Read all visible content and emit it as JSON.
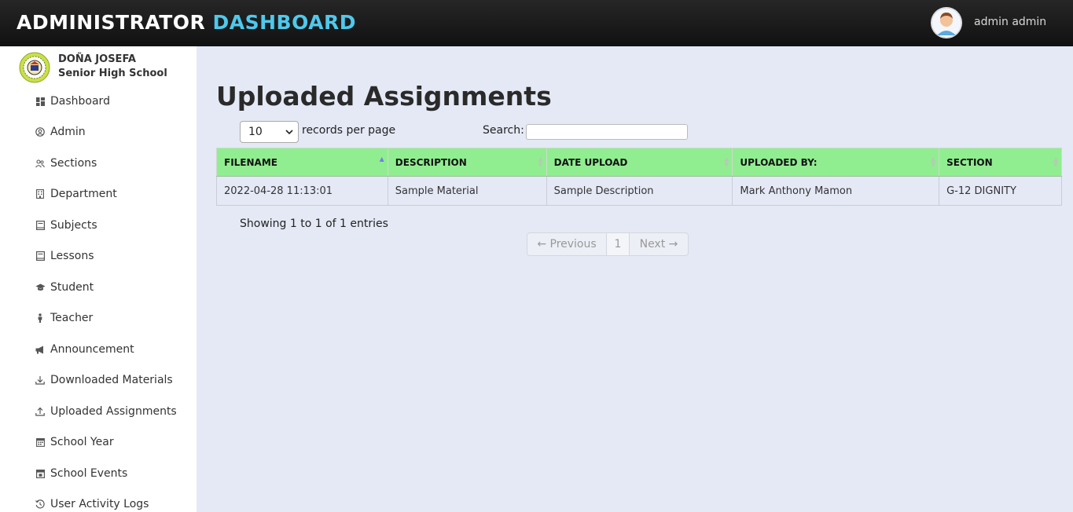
{
  "header": {
    "brand_white": "ADMINISTRATOR",
    "brand_blue": "DASHBOARD",
    "username": "admin admin"
  },
  "school": {
    "line1": "DOÑA JOSEFA",
    "line2": "Senior High School"
  },
  "sidebar": {
    "items": [
      {
        "label": "Dashboard",
        "icon": "dashboard-icon"
      },
      {
        "label": "Admin",
        "icon": "user-circle-icon"
      },
      {
        "label": "Sections",
        "icon": "users-icon"
      },
      {
        "label": "Department",
        "icon": "building-icon"
      },
      {
        "label": "Subjects",
        "icon": "book-icon"
      },
      {
        "label": "Lessons",
        "icon": "book-icon"
      },
      {
        "label": "Student",
        "icon": "graduation-cap-icon"
      },
      {
        "label": "Teacher",
        "icon": "person-icon"
      },
      {
        "label": "Announcement",
        "icon": "megaphone-icon"
      },
      {
        "label": "Downloaded Materials",
        "icon": "download-icon"
      },
      {
        "label": "Uploaded Assignments",
        "icon": "upload-icon"
      },
      {
        "label": "School Year",
        "icon": "calendar-icon"
      },
      {
        "label": "School Events",
        "icon": "calendar-event-icon"
      },
      {
        "label": "User Activity Logs",
        "icon": "history-icon"
      }
    ]
  },
  "main": {
    "title": "Uploaded Assignments",
    "length_value": "10",
    "length_label": "records per page",
    "search_label": "Search:",
    "search_value": "",
    "columns": [
      "FILENAME",
      "DESCRIPTION",
      "DATE UPLOAD",
      "UPLOADED BY:",
      "SECTION"
    ],
    "rows": [
      [
        "2022-04-28 11:13:01",
        "Sample Material",
        "Sample Description",
        "Mark Anthony Mamon",
        "G-12 DIGNITY"
      ]
    ],
    "info": "Showing 1 to 1 of 1 entries",
    "pager": {
      "prev": "← Previous",
      "page": "1",
      "next": "Next →"
    }
  },
  "colors": {
    "topbar": "#1a1a1a",
    "brand_blue": "#4fc8ec",
    "table_header": "#90ee90",
    "content_bg": "#e4e9f5"
  }
}
